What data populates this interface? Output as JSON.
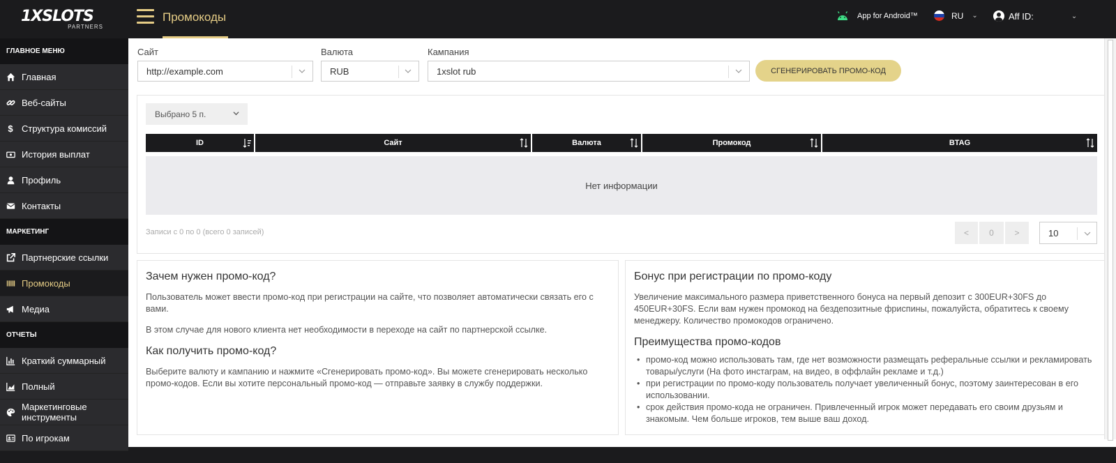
{
  "logo": {
    "brand": "1XSLOTS",
    "sub": "PARTNERS"
  },
  "header": {
    "title": "Промокоды",
    "android": "App for Android™",
    "lang": "RU",
    "aff": "Aff ID:"
  },
  "sidebar": {
    "sections": [
      {
        "title": "ГЛАВНОЕ МЕНЮ",
        "items": [
          {
            "label": "Главная",
            "icon": "home-icon"
          },
          {
            "label": "Веб-сайты",
            "icon": "link-icon"
          },
          {
            "label": "Структура комиссий",
            "icon": "dollar-icon"
          },
          {
            "label": "История выплат",
            "icon": "cash-icon"
          },
          {
            "label": "Профиль",
            "icon": "user-icon"
          },
          {
            "label": "Контакты",
            "icon": "envelope-icon"
          }
        ]
      },
      {
        "title": "МАРКЕТИНГ",
        "items": [
          {
            "label": "Партнерские ссылки",
            "icon": "external-link-icon"
          },
          {
            "label": "Промокоды",
            "icon": "barcode-icon",
            "active": true
          },
          {
            "label": "Медиа",
            "icon": "megaphone-icon"
          }
        ]
      },
      {
        "title": "ОТЧЕТЫ",
        "items": [
          {
            "label": "Краткий суммарный",
            "icon": "bar-chart-icon"
          },
          {
            "label": "Полный",
            "icon": "area-chart-icon"
          },
          {
            "label": "Маркетинговые инструменты",
            "icon": "palette-icon"
          },
          {
            "label": "По игрокам",
            "icon": "id-card-icon"
          }
        ]
      }
    ]
  },
  "filters": {
    "site_label": "Сайт",
    "site_value": "http://example.com",
    "currency_label": "Валюта",
    "currency_value": "RUB",
    "campaign_label": "Кампания",
    "campaign_value": "1xslot rub",
    "generate_button": "СГЕНЕРИРОВАТЬ ПРОМО-КОД"
  },
  "table": {
    "selected_columns": "Выбрано 5 п.",
    "columns": [
      "ID",
      "Сайт",
      "Валюта",
      "Промокод",
      "BTAG"
    ],
    "empty_text": "Нет информации",
    "records_text": "Записи с 0 по 0 (всего 0 записей)",
    "pager": {
      "prev": "<",
      "current": "0",
      "next": ">"
    },
    "per_page": "10"
  },
  "info_left": {
    "h1": "Зачем нужен промо-код?",
    "p1": "Пользователь может ввести промо-код при регистрации на сайте, что позволяет автоматически связать его с вами.",
    "p2": "В этом случае для нового клиента нет необходимости в переходе на сайт по партнерской ссылке.",
    "h2": "Как получить промо-код?",
    "p3": "Выберите валюту и кампанию и нажмите «Сгенерировать промо-код». Вы можете сгенерировать несколько промо-кодов. Если вы хотите персональный промо-код — отправьте заявку в службу поддержки."
  },
  "info_right": {
    "h1": "Бонус при регистрации по промо-коду",
    "p1": "Увеличение максимального размера приветственного бонуса на первый депозит с 300EUR+30FS до 450EUR+30FS. Если вам нужен промокод на бездепозитные фриспины, пожалуйста, обратитесь к своему менеджеру. Количество промокодов ограничено.",
    "h2": "Преимущества промо-кодов",
    "bullets": [
      "промо-код можно использовать там, где нет возможности размещать реферальные ссылки и рекламировать товары/услуги (На фото инстаграм, на видео, в оффлайн рекламе и т.д.)",
      "при регистрации по промо-коду пользователь получает увеличенный бонус, поэтому заинтересован в его использовании.",
      "срок действия промо-кода не ограничен. Привлеченный игрок может передавать его своим друзьям и знакомым. Чем больше игроков, тем выше ваш доход."
    ]
  },
  "colors": {
    "accent": "#e6cd86",
    "dark": "#1b1b1d",
    "button": "#e4d38a"
  }
}
